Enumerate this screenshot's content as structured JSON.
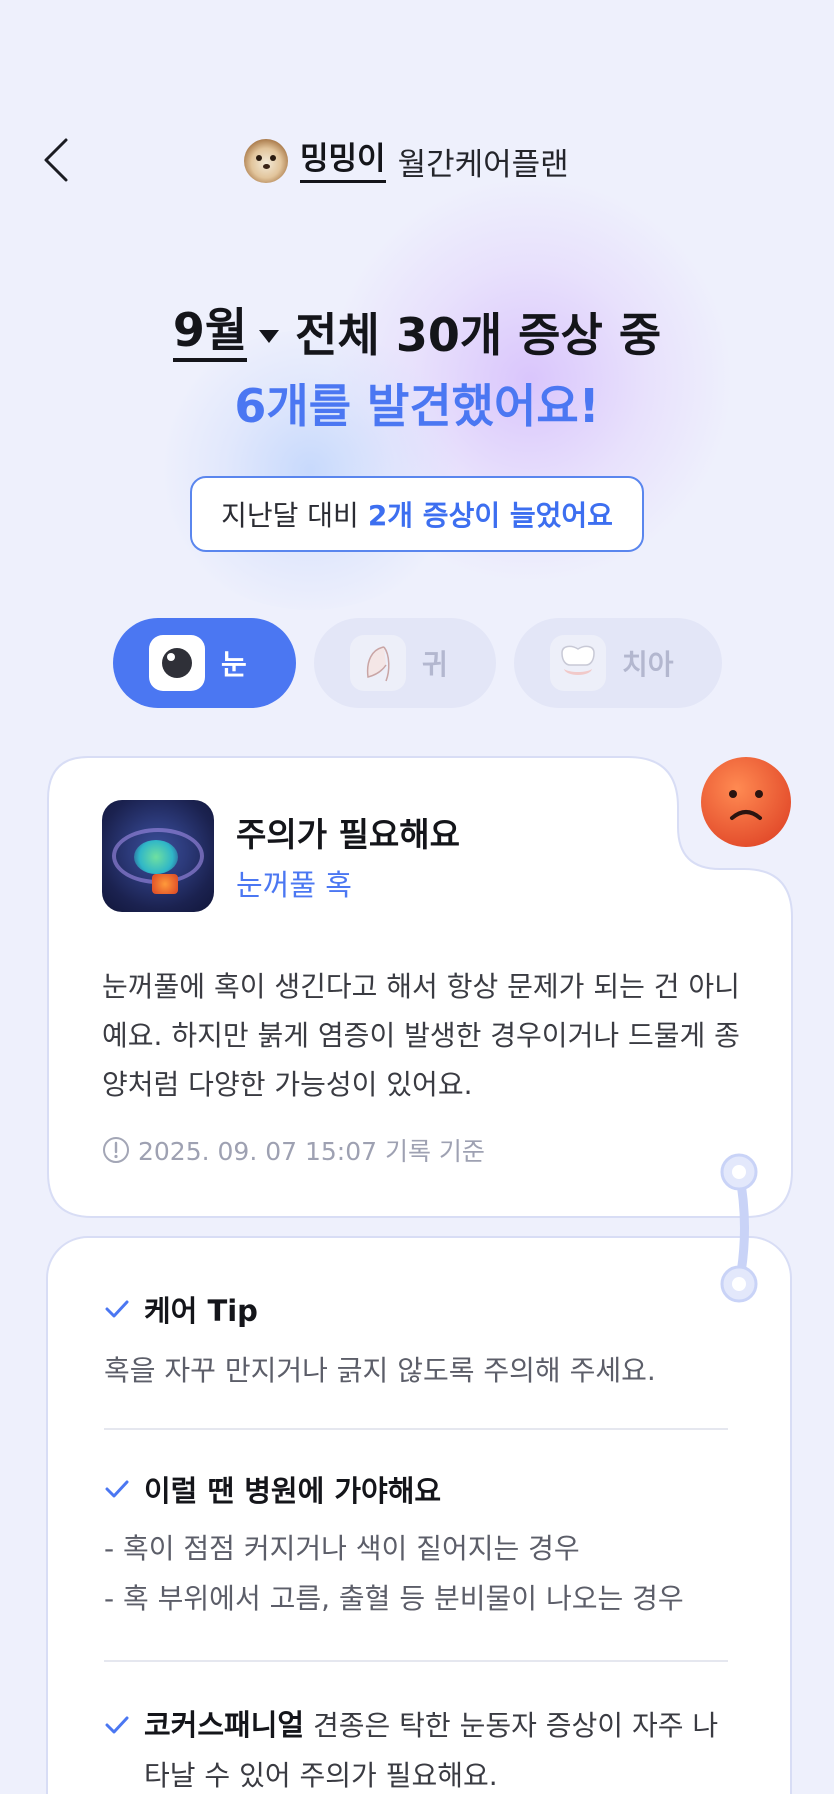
{
  "header": {
    "back_icon": "chevron-left-icon",
    "pet_name": "밍밍이",
    "title": "월간케어플랜"
  },
  "headline": {
    "month": "9월",
    "summary": "전체 30개 증상 중",
    "found": "6개를 발견했어요!"
  },
  "comparison": {
    "prefix": "지난달 대비",
    "highlight": "2개 증상이 늘었어요"
  },
  "tabs": [
    {
      "label": "눈",
      "icon": "eye-icon",
      "selected": true
    },
    {
      "label": "귀",
      "icon": "ear-icon",
      "selected": false
    },
    {
      "label": "치아",
      "icon": "tooth-icon",
      "selected": false
    }
  ],
  "symptom_card": {
    "status_icon": "sad-face-icon",
    "status": "주의가 필요해요",
    "symptom": "눈꺼풀 혹",
    "description": "눈꺼풀에 혹이 생긴다고 해서 항상 문제가 되는 건 아니예요. 하지만 붉게 염증이 발생한 경우이거나 드물게 종양처럼 다양한 가능성이 있어요.",
    "record_note": "2025. 09. 07 15:07 기록 기준"
  },
  "tips": {
    "care_tip_title": "케어 Tip",
    "care_tip_body": "혹을 자꾸 만지거나 긁지 않도록 주의해 주세요.",
    "hospital_title": "이럴 땐 병원에 가야해요",
    "hospital_items": [
      "- 혹이 점점 커지거나 색이 짙어지는 경우",
      "- 혹 부위에서 고름, 출혈 등 분비물이 나오는 경우"
    ],
    "breed_name": "코커스패니얼",
    "breed_note": " 견종은 탁한 눈동자 증상이 자주 나타날 수 있어 주의가 필요해요."
  },
  "colors": {
    "accent": "#4b77f2",
    "background": "#eef0fc",
    "warning": "#ec5a34"
  }
}
